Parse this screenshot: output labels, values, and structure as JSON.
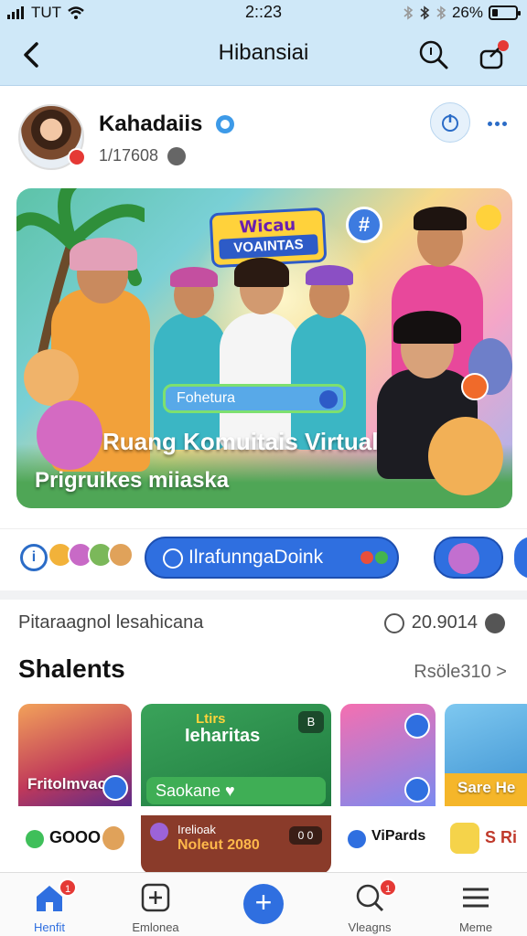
{
  "status_bar": {
    "carrier": "TUT",
    "time": "2::23",
    "battery": "26%",
    "battery_level": 0.26
  },
  "header": {
    "title": "Hibansiai"
  },
  "post": {
    "author": "Kahadaiis",
    "meta": "1/17608"
  },
  "banner": {
    "logo_top": "Wicau",
    "logo_bottom": "VOAINTAS",
    "hash": "#",
    "pill": "Fohetura",
    "title": "Ruang Komuitais Virtual",
    "subtitle": "Prigruikes miiaska"
  },
  "actions": {
    "info_symbol": "i",
    "main_button": "IlrafunngaDoink"
  },
  "stats": {
    "text": "Pitaraagnol lesahicana",
    "count": "20.9014"
  },
  "section": {
    "title": "Shalents",
    "link": "Rsöle310 >"
  },
  "cards": [
    {
      "label": "Fritolmvac",
      "lower": "GOOO"
    },
    {
      "label": "Ieharitas",
      "top": "Ltirs",
      "sub": "Saokane ♥",
      "badge": "B",
      "lower_top": "Irelioak",
      "lower": "Noleut 2080",
      "lower_badge": "0 0"
    },
    {
      "label": "",
      "lower": "ViPards"
    },
    {
      "label": "Sare He",
      "lower": "S Ri"
    }
  ],
  "nav": [
    {
      "label": "Henfit",
      "badge": "1"
    },
    {
      "label": "Emlonea"
    },
    {
      "label": "+"
    },
    {
      "label": "Vleagns",
      "badge": "1"
    },
    {
      "label": "Meme"
    }
  ],
  "colors": {
    "header_bg": "#cfe8f8",
    "accent": "#2f6fe0",
    "badge": "#e53935"
  }
}
